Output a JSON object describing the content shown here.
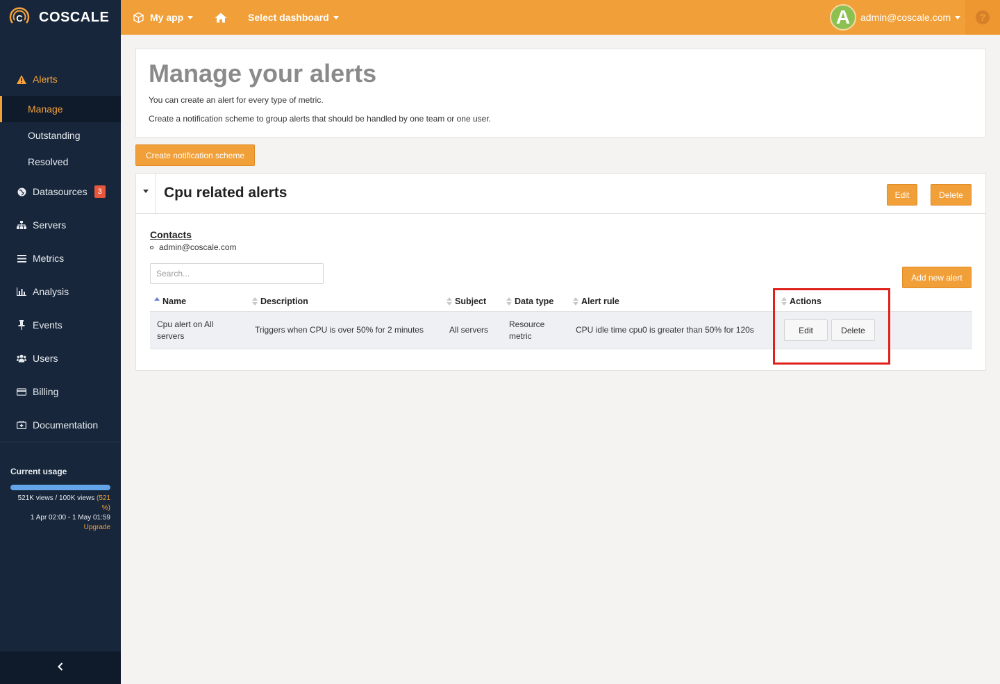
{
  "brand": {
    "name": "COSCALE"
  },
  "topbar": {
    "app_label": "My app",
    "dashboard_label": "Select dashboard",
    "user_initial": "A",
    "user_email": "admin@coscale.com",
    "help_symbol": "?"
  },
  "sidebar": {
    "alerts_label": "Alerts",
    "alerts_sub": [
      "Manage",
      "Outstanding",
      "Resolved"
    ],
    "items": [
      {
        "label": "Datasources",
        "icon": "globe-icon",
        "badge": "3"
      },
      {
        "label": "Servers",
        "icon": "sitemap-icon"
      },
      {
        "label": "Metrics",
        "icon": "list-icon"
      },
      {
        "label": "Analysis",
        "icon": "bar-chart-icon"
      },
      {
        "label": "Events",
        "icon": "pin-icon"
      },
      {
        "label": "Users",
        "icon": "users-icon"
      },
      {
        "label": "Billing",
        "icon": "credit-card-icon"
      },
      {
        "label": "Documentation",
        "icon": "medkit-icon"
      }
    ],
    "usage": {
      "title": "Current usage",
      "views_text": "521K views / 100K views",
      "percent_text": "(521 %)",
      "fill_fraction": 1.0,
      "period": "1 Apr 02:00 - 1 May 01:59",
      "upgrade_label": "Upgrade"
    }
  },
  "header": {
    "title": "Manage your alerts",
    "line1": "You can create an alert for every type of metric.",
    "line2": "Create a notification scheme to group alerts that should be handled by one team or one user."
  },
  "create_scheme_label": "Create notification scheme",
  "scheme": {
    "title": "Cpu related alerts",
    "edit_label": "Edit",
    "delete_label": "Delete",
    "contacts_title": "Contacts",
    "contacts": [
      "admin@coscale.com"
    ],
    "search_placeholder": "Search...",
    "add_alert_label": "Add new alert",
    "columns": [
      "Name",
      "Description",
      "Subject",
      "Data type",
      "Alert rule",
      "Actions"
    ],
    "rows": [
      {
        "name": "Cpu alert on All servers",
        "description": "Triggers when CPU is over 50% for 2 minutes",
        "subject": "All servers",
        "data_type": "Resource metric",
        "alert_rule": "CPU idle time cpu0 is greater than 50% for 120s",
        "edit_label": "Edit",
        "delete_label": "Delete"
      }
    ]
  },
  "colors": {
    "accent": "#f19f38",
    "sidebar_bg": "#17263a",
    "highlight": "#e0201b",
    "badge": "#e8573c"
  }
}
